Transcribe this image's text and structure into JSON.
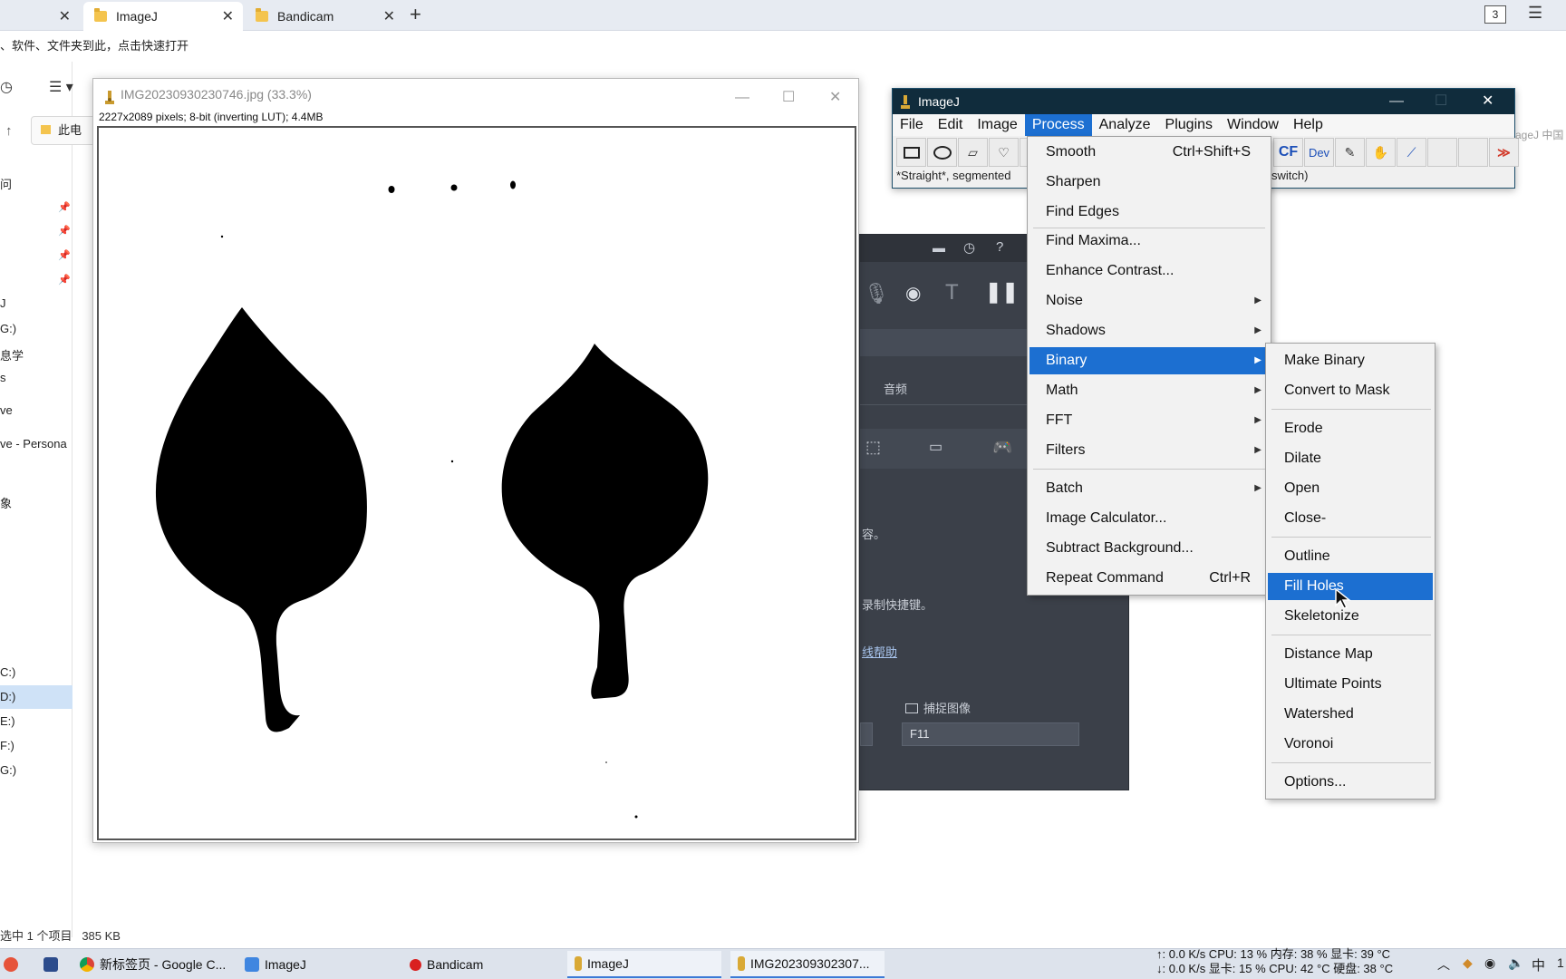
{
  "explorer": {
    "tabs": [
      {
        "label": "ImageJ"
      },
      {
        "label": "Bandicam"
      }
    ],
    "tab_count": "3",
    "hint": "、软件、文件夹到此，点击快速打开",
    "address": "此电",
    "nav": [
      "问",
      "J",
      "G:)",
      "息学",
      "s",
      "ve",
      "ve - Persona",
      "象",
      "C:)",
      "D:)",
      "E:)",
      "F:)",
      "G:)"
    ],
    "status_selected": "选中 1 个项目",
    "status_size": "385 KB"
  },
  "image_window": {
    "title": "IMG20230930230746.jpg (33.3%)",
    "info": "2227x2089 pixels; 8-bit (inverting LUT); 4.4MB"
  },
  "bandicam": {
    "tab_audio": "音频",
    "text_1": "容。",
    "text_2": "录制快捷键。",
    "link_help": "线帮助",
    "capture_label": "捕捉图像",
    "capture_value": "F11"
  },
  "imagej": {
    "title": "ImageJ",
    "menus": [
      "File",
      "Edit",
      "Image",
      "Process",
      "Analyze",
      "Plugins",
      "Window",
      "Help"
    ],
    "status_left": "*Straight*, segmented",
    "status_right": "switch)",
    "tool_cf": "CF",
    "tool_dev": "Dev",
    "right_edge_text": "ageJ 中国"
  },
  "process_menu": {
    "items": [
      {
        "label": "Smooth",
        "shortcut": "Ctrl+Shift+S"
      },
      {
        "label": "Sharpen"
      },
      {
        "label": "Find Edges"
      },
      {
        "label": "Find Maxima..."
      },
      {
        "label": "Enhance Contrast..."
      },
      {
        "label": "Noise"
      },
      {
        "label": "Shadows"
      },
      {
        "label": "Binary"
      },
      {
        "label": "Math"
      },
      {
        "label": "FFT"
      },
      {
        "label": "Filters"
      },
      {
        "label": "Batch"
      },
      {
        "label": "Image Calculator..."
      },
      {
        "label": "Subtract Background..."
      },
      {
        "label": "Repeat Command",
        "shortcut": "Ctrl+R"
      }
    ]
  },
  "binary_menu": {
    "items": [
      "Make Binary",
      "Convert to Mask",
      "Erode",
      "Dilate",
      "Open",
      "Close-",
      "Outline",
      "Fill Holes",
      "Skeletonize",
      "Distance Map",
      "Ultimate Points",
      "Watershed",
      "Voronoi",
      "Options..."
    ]
  },
  "taskbar": {
    "items": [
      "新标签页 - Google C...",
      "ImageJ",
      "Bandicam",
      "ImageJ",
      "IMG202309302307..."
    ],
    "tray_line1": "↑:    0.0 K/s CPU: 13 % 内存:  38 % 显卡: 39 °C",
    "tray_line2": "↓:    0.0 K/s 显卡: 15 % CPU: 42 °C 硬盘: 38 °C",
    "ime": "中",
    "clock_partial": "1"
  },
  "colors": {
    "menu_highlight": "#1c6fd1",
    "imagej_titlebar": "#102c3c",
    "bandicam_bg": "#3b4049"
  }
}
